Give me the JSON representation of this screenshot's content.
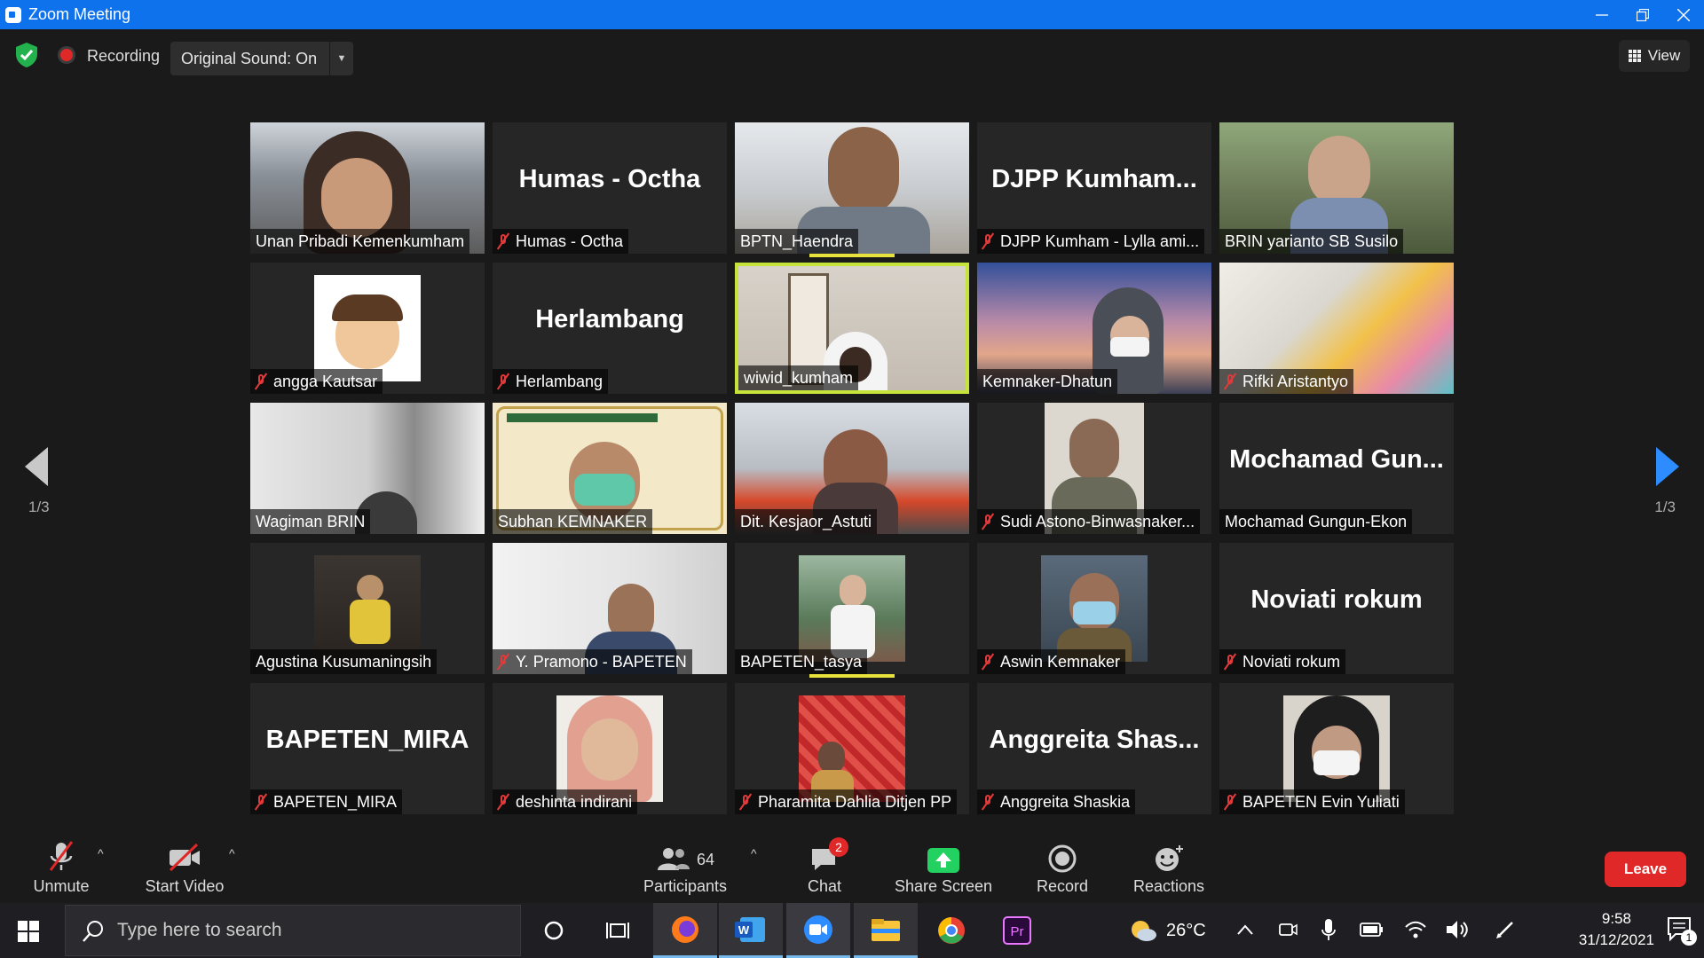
{
  "window": {
    "title": "Zoom Meeting"
  },
  "meeting_bar": {
    "recording_label": "Recording",
    "original_sound_label": "Original Sound: On",
    "view_label": "View"
  },
  "pagination": {
    "left": "1/3",
    "right": "1/3"
  },
  "tiles": [
    {
      "name": "Unan Pribadi Kemenkumham",
      "muted": false,
      "big": ""
    },
    {
      "name": "Humas - Octha",
      "muted": true,
      "big": "Humas - Octha"
    },
    {
      "name": "BPTN_Haendra",
      "muted": false,
      "big": ""
    },
    {
      "name": "DJPP Kumham - Lylla ami...",
      "muted": true,
      "big": "DJPP  Kumham..."
    },
    {
      "name": "BRIN yarianto SB Susilo",
      "muted": false,
      "big": ""
    },
    {
      "name": "angga Kautsar",
      "muted": true,
      "big": ""
    },
    {
      "name": "Herlambang",
      "muted": true,
      "big": "Herlambang"
    },
    {
      "name": "wiwid_kumham",
      "muted": false,
      "big": ""
    },
    {
      "name": "Kemnaker-Dhatun",
      "muted": false,
      "big": ""
    },
    {
      "name": "Rifki Aristantyo",
      "muted": true,
      "big": ""
    },
    {
      "name": "Wagiman BRIN",
      "muted": false,
      "big": ""
    },
    {
      "name": "Subhan KEMNAKER",
      "muted": false,
      "big": ""
    },
    {
      "name": "Dit. Kesjaor_Astuti",
      "muted": false,
      "big": ""
    },
    {
      "name": "Sudi Astono-Binwasnaker...",
      "muted": true,
      "big": ""
    },
    {
      "name": "Mochamad Gungun-Ekon",
      "muted": false,
      "big": "Mochamad  Gun..."
    },
    {
      "name": "Agustina Kusumaningsih",
      "muted": false,
      "big": ""
    },
    {
      "name": "Y. Pramono - BAPETEN",
      "muted": true,
      "big": ""
    },
    {
      "name": "BAPETEN_tasya",
      "muted": false,
      "big": ""
    },
    {
      "name": "Aswin Kemnaker",
      "muted": true,
      "big": ""
    },
    {
      "name": "Noviati rokum",
      "muted": true,
      "big": "Noviati rokum"
    },
    {
      "name": "BAPETEN_MIRA",
      "muted": true,
      "big": "BAPETEN_MIRA"
    },
    {
      "name": "deshinta indirani",
      "muted": true,
      "big": ""
    },
    {
      "name": "Pharamita Dahlia Ditjen PP",
      "muted": true,
      "big": ""
    },
    {
      "name": "Anggreita Shaskia",
      "muted": true,
      "big": "Anggreita  Shas..."
    },
    {
      "name": "BAPETEN Evin Yuliati",
      "muted": true,
      "big": ""
    }
  ],
  "toolbar": {
    "unmute": "Unmute",
    "start_video": "Start Video",
    "participants_count": "64",
    "participants": "Participants",
    "chat": "Chat",
    "chat_badge": "2",
    "share_screen": "Share Screen",
    "record": "Record",
    "reactions": "Reactions",
    "leave": "Leave"
  },
  "taskbar": {
    "search_placeholder": "Type here to search",
    "temperature": "26°C",
    "time": "9:58",
    "date": "31/12/2021",
    "notification_count": "1"
  },
  "colors": {
    "titlebar": "#0e72ed",
    "leave": "#e02828",
    "share": "#23d160",
    "active_speaker": "#c6e33b",
    "mute_red": "#e23a3a"
  }
}
